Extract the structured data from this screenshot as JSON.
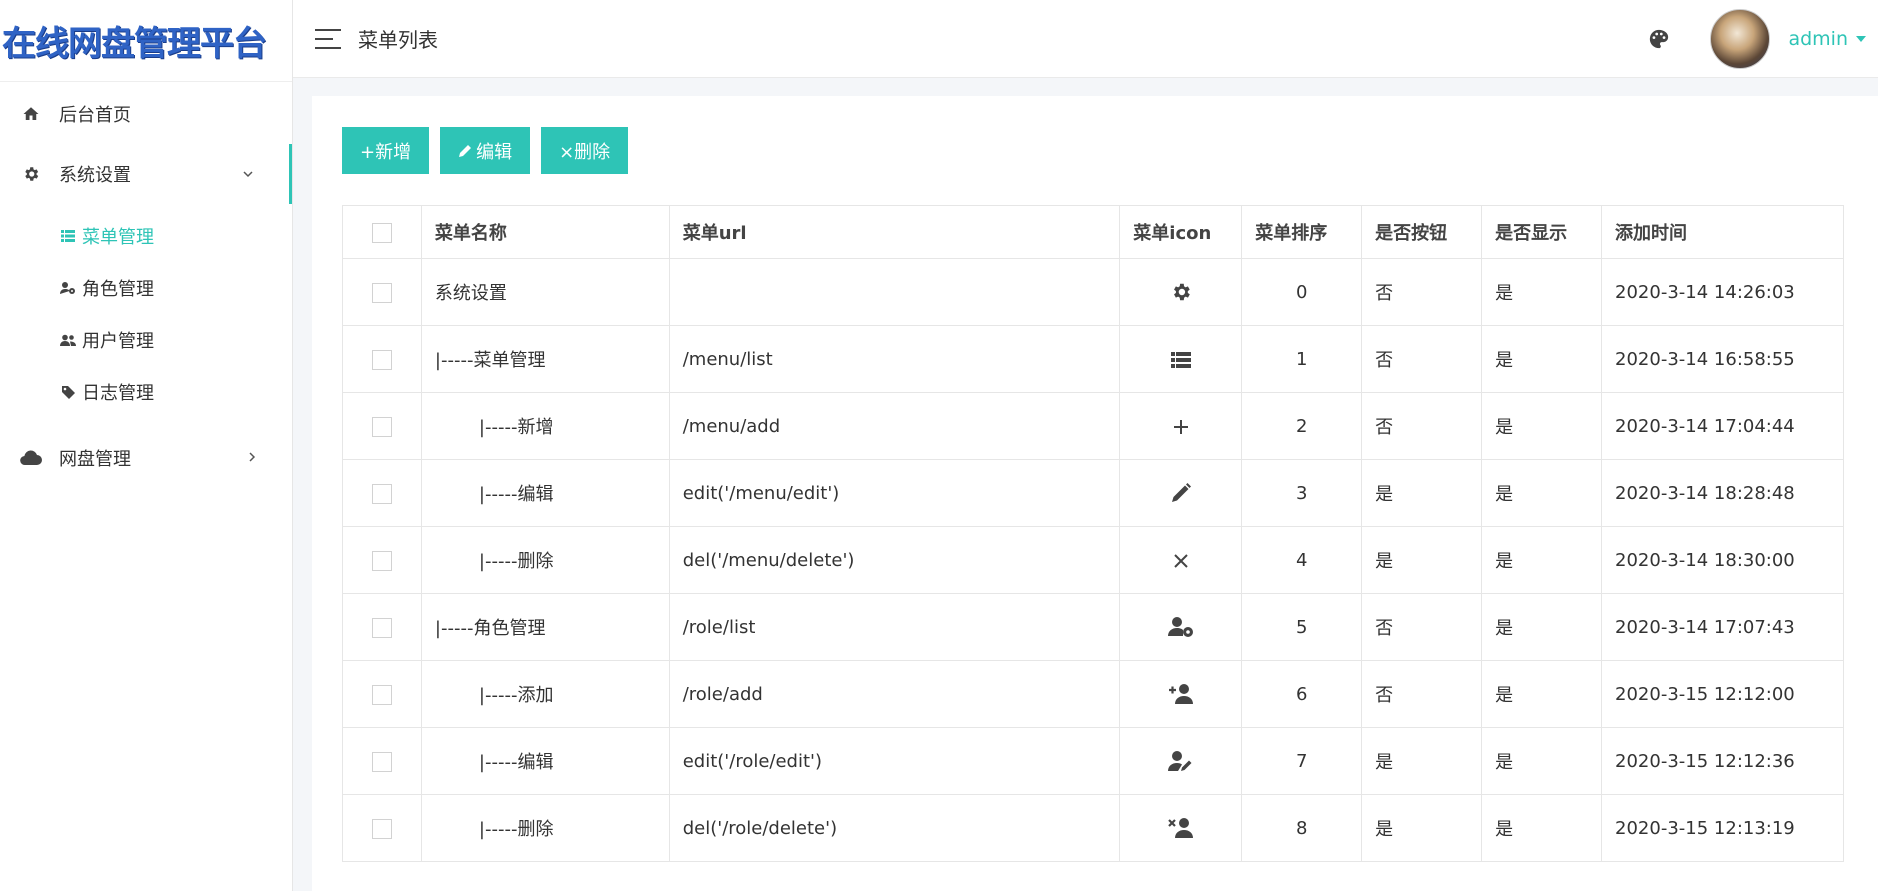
{
  "app": {
    "logo_text": "在线网盘管理平台",
    "page_title": "菜单列表",
    "user_name": "admin"
  },
  "sidebar": {
    "items": [
      {
        "label": "后台首页",
        "icon": "home-icon"
      },
      {
        "label": "系统设置",
        "icon": "gear-icon",
        "expanded": true
      },
      {
        "label": "网盘管理",
        "icon": "cloud-icon",
        "expanded": false
      }
    ],
    "sub_items": [
      {
        "label": "菜单管理",
        "icon": "list-icon",
        "active": true
      },
      {
        "label": "角色管理",
        "icon": "user-gear-icon"
      },
      {
        "label": "用户管理",
        "icon": "users-icon"
      },
      {
        "label": "日志管理",
        "icon": "tags-icon"
      }
    ]
  },
  "toolbar": {
    "add_label": "+新增",
    "edit_label": "编辑",
    "delete_label": "×删除"
  },
  "table": {
    "headers": [
      "菜单名称",
      "菜单url",
      "菜单icon",
      "菜单排序",
      "是否按钮",
      "是否显示",
      "添加时间"
    ],
    "rows": [
      {
        "name": "系统设置",
        "url": "",
        "icon": "gear-icon",
        "order": "0",
        "is_button": "否",
        "is_show": "是",
        "time": "2020-3-14 14:26:03"
      },
      {
        "name": "|-----菜单管理",
        "url": "/menu/list",
        "icon": "list-icon",
        "order": "1",
        "is_button": "否",
        "is_show": "是",
        "time": "2020-3-14 16:58:55"
      },
      {
        "name": "|-----新增",
        "url": "/menu/add",
        "icon": "plus-icon",
        "order": "2",
        "is_button": "否",
        "is_show": "是",
        "time": "2020-3-14 17:04:44"
      },
      {
        "name": "|-----编辑",
        "url": "edit('/menu/edit')",
        "icon": "pencil-icon",
        "order": "3",
        "is_button": "是",
        "is_show": "是",
        "time": "2020-3-14 18:28:48"
      },
      {
        "name": "|-----删除",
        "url": "del('/menu/delete')",
        "icon": "close-icon",
        "order": "4",
        "is_button": "是",
        "is_show": "是",
        "time": "2020-3-14 18:30:00"
      },
      {
        "name": "|-----角色管理",
        "url": "/role/list",
        "icon": "user-gear-icon",
        "order": "5",
        "is_button": "否",
        "is_show": "是",
        "time": "2020-3-14 17:07:43"
      },
      {
        "name": "|-----添加",
        "url": "/role/add",
        "icon": "user-plus-icon",
        "order": "6",
        "is_button": "否",
        "is_show": "是",
        "time": "2020-3-15 12:12:00"
      },
      {
        "name": "|-----编辑",
        "url": "edit('/role/edit')",
        "icon": "user-edit-icon",
        "order": "7",
        "is_button": "是",
        "is_show": "是",
        "time": "2020-3-15 12:12:36"
      },
      {
        "name": "|-----删除",
        "url": "del('/role/delete')",
        "icon": "user-times-icon",
        "order": "8",
        "is_button": "是",
        "is_show": "是",
        "time": "2020-3-15 12:13:19"
      }
    ]
  },
  "colors": {
    "accent": "#2ec4b6",
    "yes": "#1bb57a",
    "no": "#3a9bd9",
    "logo": "#2f63c5"
  }
}
